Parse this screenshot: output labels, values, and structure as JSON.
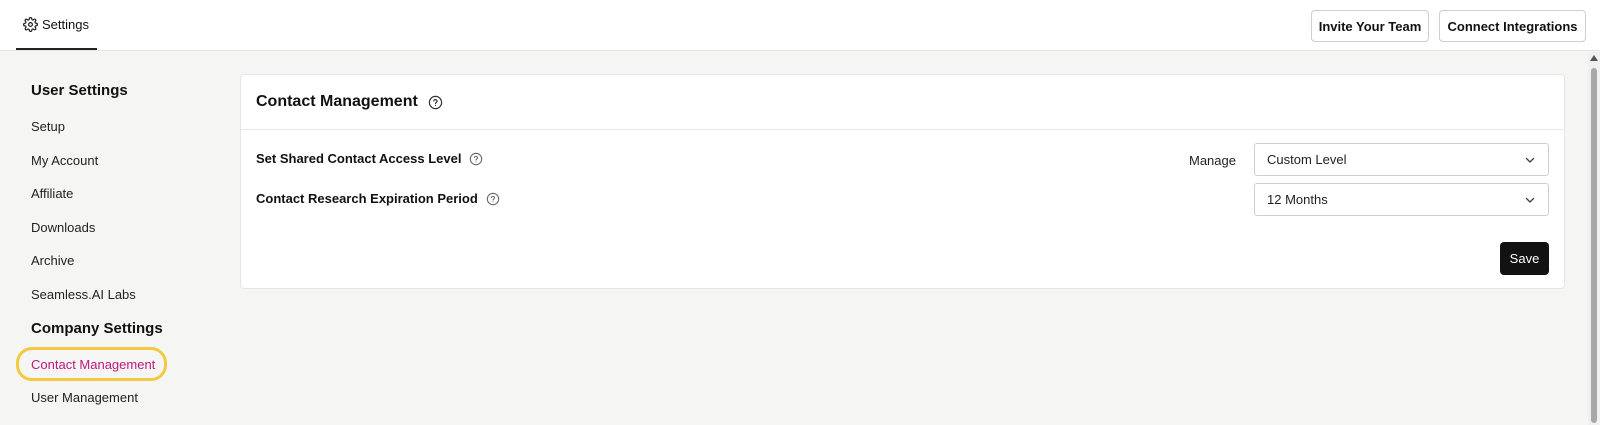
{
  "header": {
    "tab_settings": "Settings",
    "invite_button": "Invite Your Team",
    "connect_button": "Connect Integrations"
  },
  "sidebar": {
    "user_settings_heading": "User Settings",
    "items": [
      {
        "label": "Setup"
      },
      {
        "label": "My Account"
      },
      {
        "label": "Affiliate"
      },
      {
        "label": "Downloads"
      },
      {
        "label": "Archive"
      },
      {
        "label": "Seamless.AI Labs"
      }
    ],
    "company_settings_heading": "Company Settings",
    "company_items": [
      {
        "label": "Contact Management",
        "active": true
      },
      {
        "label": "User Management"
      }
    ]
  },
  "main": {
    "title": "Contact Management",
    "rows": [
      {
        "label": "Set Shared Contact Access Level",
        "prefix": "Manage",
        "value": "Custom Level"
      },
      {
        "label": "Contact Research Expiration Period",
        "value": "12 Months"
      }
    ],
    "save_label": "Save"
  },
  "colors": {
    "active_text": "#c0177f",
    "highlight_ring": "#f5c842",
    "save_bg": "#121212"
  }
}
